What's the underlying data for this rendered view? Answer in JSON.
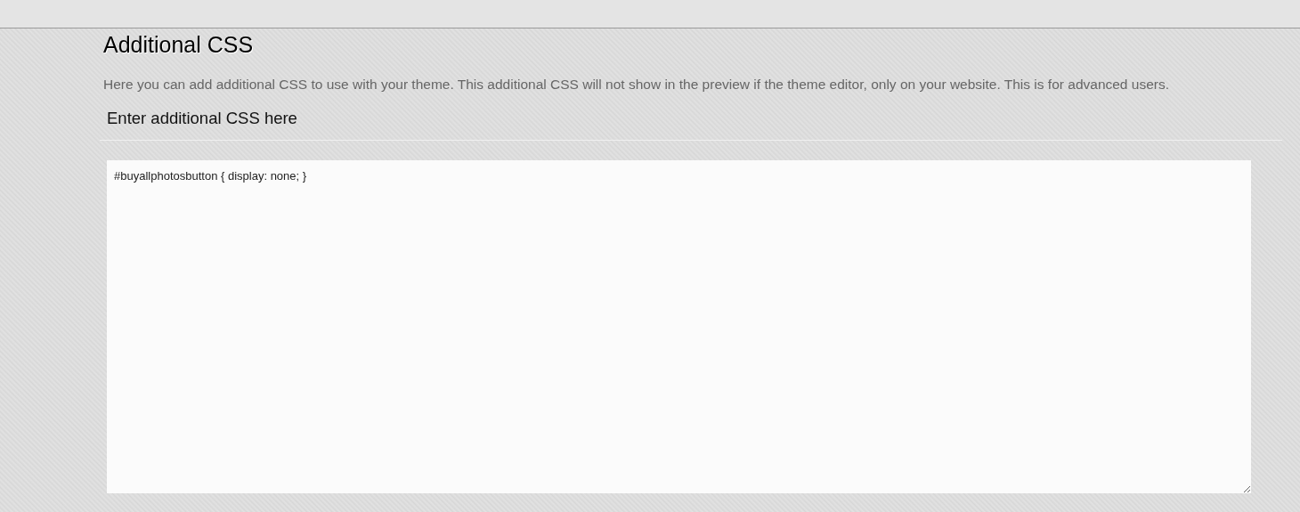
{
  "section": {
    "title": "Additional CSS",
    "description": "Here you can add additional CSS to use with your theme. This additional CSS will not show in the preview if the theme editor, only on your website. This is for advanced users.",
    "field_label": "Enter additional CSS here",
    "css_value": "#buyallphotosbutton { display: none; }"
  }
}
